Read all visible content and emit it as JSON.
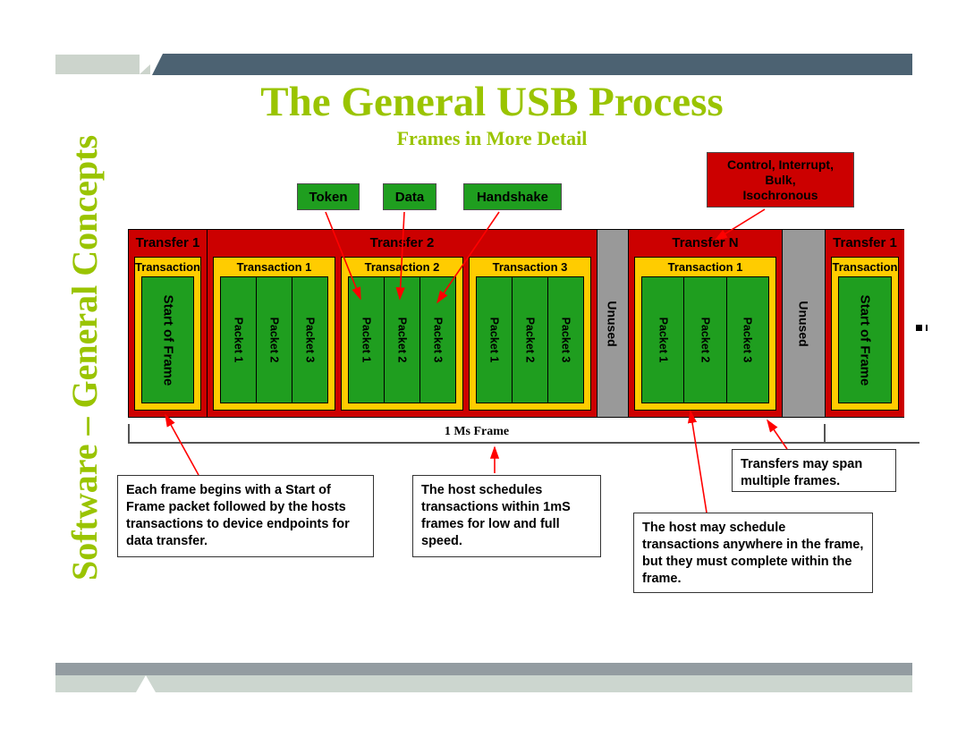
{
  "sidebar": {
    "title": "Software – General Concepts"
  },
  "header": {
    "title": "The General USB Process",
    "subtitle": "Frames in More Detail"
  },
  "colors": {
    "accent_green": "#9ac400",
    "transfer_red": "#cc0000",
    "transaction_yellow": "#ffcc00",
    "packet_green": "#1f9e1f",
    "unused_gray": "#999999",
    "header_slate": "#4c6272",
    "header_light": "#ccd4cc",
    "leader_red": "#ff0000"
  },
  "chips": {
    "token": "Token",
    "data": "Data",
    "handshake": "Handshake",
    "transfer_types": "Control, Interrupt,\nBulk,\nIsochronous",
    "transfer_types_line1": "Control, Interrupt,",
    "transfer_types_line2": "Bulk,",
    "transfer_types_line3": "Isochronous"
  },
  "diagram": {
    "transfers": [
      {
        "label": "Transfer 1",
        "transactions": [
          {
            "label": "Transaction",
            "packets": [
              "Start of Frame"
            ]
          }
        ]
      },
      {
        "label": "Transfer 2",
        "transactions": [
          {
            "label": "Transaction 1",
            "packets": [
              "Packet 1",
              "Packet 2",
              "Packet 3"
            ]
          },
          {
            "label": "Transaction 2",
            "packets": [
              "Packet 1",
              "Packet 2",
              "Packet 3"
            ]
          },
          {
            "label": "Transaction 3",
            "packets": [
              "Packet 1",
              "Packet 2",
              "Packet 3"
            ]
          }
        ]
      },
      {
        "label": "Unused"
      },
      {
        "label": "Transfer N",
        "transactions": [
          {
            "label": "Transaction 1",
            "packets": [
              "Packet 1",
              "Packet 2",
              "Packet 3"
            ]
          }
        ]
      },
      {
        "label": "Unused"
      },
      {
        "label": "Transfer 1",
        "transactions": [
          {
            "label": "Transaction",
            "packets": [
              "Start of Frame"
            ]
          }
        ]
      }
    ]
  },
  "dimension": {
    "label": "1 Ms Frame"
  },
  "notes": {
    "note1": "Each frame begins with a Start of Frame packet followed by the hosts transactions to device endpoints for data transfer.",
    "note2": "The host schedules transactions within 1mS frames for low and full speed.",
    "note3": "Transfers may span multiple frames.",
    "note4": "The host may schedule transactions anywhere in the frame, but they must complete within the frame."
  }
}
